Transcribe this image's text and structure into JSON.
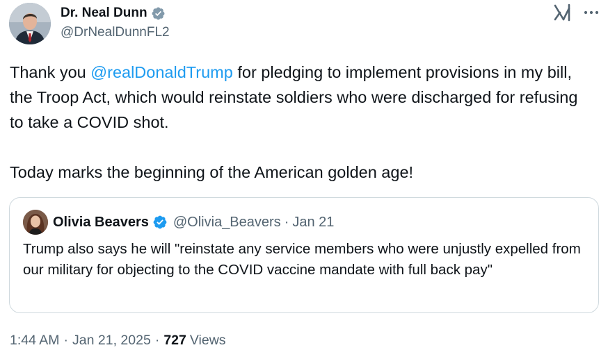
{
  "author": {
    "name": "Dr. Neal Dunn",
    "handle": "@DrNealDunnFL2",
    "verified": true
  },
  "header_icons": {
    "grok": "grok-icon",
    "more": "more-options-icon"
  },
  "tweet": {
    "mention": "@realDonaldTrump",
    "text_before_mention": "Thank you ",
    "text_after_mention": " for pledging to implement provisions in my bill, the Troop Act, which would reinstate soldiers who were discharged for refusing to take a COVID shot.\n\nToday marks the beginning of the American golden age!"
  },
  "quote": {
    "name": "Olivia Beavers",
    "handle": "@Olivia_Beavers",
    "separator": "·",
    "date": "Jan 21",
    "verified": true,
    "text": "Trump also says he will \"reinstate any service members who were unjustly expelled from our military for objecting to the COVID vaccine mandate with full back pay\""
  },
  "meta": {
    "time": "1:44 AM",
    "separator": "·",
    "date": "Jan 21, 2025",
    "views_count": "727",
    "views_label": "Views"
  },
  "colors": {
    "accent": "#1d9bf0",
    "text": "#0f1419",
    "secondary": "#536471",
    "border": "#cfd9de"
  }
}
